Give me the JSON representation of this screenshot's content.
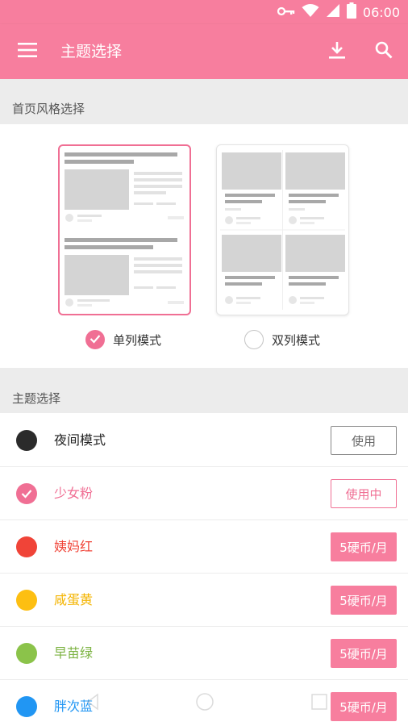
{
  "status_bar": {
    "time": "06:00",
    "battery": "100"
  },
  "app_bar": {
    "title": "主题选择"
  },
  "layout_section": {
    "header": "首页风格选择",
    "options": [
      {
        "label": "单列模式",
        "selected": true
      },
      {
        "label": "双列模式",
        "selected": false
      }
    ]
  },
  "theme_section": {
    "header": "主题选择",
    "themes": [
      {
        "name": "夜间模式",
        "color": "#2b2b2b",
        "action": "使用",
        "state": "use"
      },
      {
        "name": "少女粉",
        "color": "#f06f94",
        "action": "使用中",
        "state": "in-use"
      },
      {
        "name": "姨妈红",
        "color": "#f04438",
        "action": "5硬币/月",
        "state": "buy"
      },
      {
        "name": "咸蛋黄",
        "color": "#fdbf12",
        "action": "5硬币/月",
        "state": "buy"
      },
      {
        "name": "早苗绿",
        "color": "#8bc34a",
        "action": "5硬币/月",
        "state": "buy"
      },
      {
        "name": "胖次蓝",
        "color": "#2196f3",
        "action": "5硬币/月",
        "state": "buy"
      }
    ]
  },
  "colors": {
    "accent": "#f77e9e",
    "selected": "#f06f94"
  },
  "icons": [
    "vpn-key-icon",
    "wifi-icon",
    "signal-icon",
    "battery-icon",
    "menu-icon",
    "download-icon",
    "search-icon",
    "check-icon"
  ]
}
